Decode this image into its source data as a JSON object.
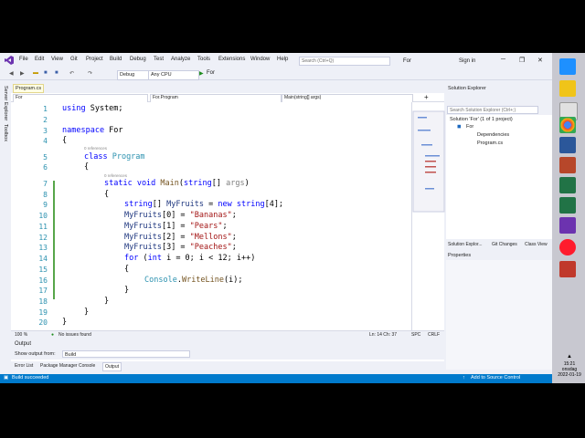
{
  "menu": [
    "File",
    "Edit",
    "View",
    "Git",
    "Project",
    "Build",
    "Debug",
    "Test",
    "Analyze",
    "Tools",
    "Extensions",
    "Window",
    "Help"
  ],
  "search_placeholder": "Search (Ctrl+Q)",
  "solution_name": "For",
  "sign_in": "Sign in",
  "toolbar": {
    "config": "Debug",
    "platform": "Any CPU",
    "run": "For"
  },
  "sidebar": [
    "Server Explorer",
    "Toolbox"
  ],
  "doc_tab": "Program.cs",
  "nav": {
    "project": "For",
    "class": "For.Program",
    "member": "Main(string[] args)"
  },
  "codelens": "0 references",
  "code_lines": [
    {
      "n": "1"
    },
    {
      "n": "2"
    },
    {
      "n": "3"
    },
    {
      "n": "4"
    },
    {
      "n": "5"
    },
    {
      "n": "6"
    },
    {
      "n": "7"
    },
    {
      "n": "8"
    },
    {
      "n": "9"
    },
    {
      "n": "10"
    },
    {
      "n": "11"
    },
    {
      "n": "12"
    },
    {
      "n": "13"
    },
    {
      "n": "14"
    },
    {
      "n": "15"
    },
    {
      "n": "16"
    },
    {
      "n": "17"
    },
    {
      "n": "18"
    },
    {
      "n": "19"
    },
    {
      "n": "20"
    }
  ],
  "code": {
    "l1_kw": "using",
    "l1_rest": " System;",
    "l3_kw": "namespace",
    "l3_rest": " For",
    "l4": "{",
    "l5_kw": "class",
    "l5_ty": " Program",
    "l6": "{",
    "l7_kw": "static void",
    "l7_mt": " Main",
    "l7_a": "(",
    "l7_kw2": "string",
    "l7_b": "[] ",
    "l7_pa": "args",
    "l7_c": ")",
    "l8": "{",
    "l9_kw": "string",
    "l9_a": "[] ",
    "l9_pa": "MyFruits",
    "l9_b": " = ",
    "l9_kw2": "new string",
    "l9_c": "[4];",
    "l10_pa": "MyFruits",
    "l10_a": "[0] = ",
    "l10_st": "\"Bananas\"",
    "l10_b": ";",
    "l11_pa": "MyFruits",
    "l11_a": "[1] = ",
    "l11_st": "\"Pears\"",
    "l11_b": ";",
    "l12_pa": "MyFruits",
    "l12_a": "[2] = ",
    "l12_st": "\"Mellons\"",
    "l12_b": ";",
    "l13_pa": "MyFruits",
    "l13_a": "[3] = ",
    "l13_st": "\"Peaches\"",
    "l13_b": ";",
    "l14_kw": "for",
    "l14_a": " (",
    "l14_kw2": "int",
    "l14_b": " i = 0; i < 12; i++)",
    "l15": "{",
    "l16_ty": "Console",
    "l16_a": ".",
    "l16_mt": "WriteLine",
    "l16_b": "(i);",
    "l17": "}",
    "l18": "}",
    "l19": "}",
    "l20": "}"
  },
  "editor_status": {
    "zoom": "100 %",
    "issues": "No issues found",
    "position": "Ln: 14   Ch: 37",
    "spc": "SPC",
    "crlf": "CRLF"
  },
  "solution_explorer": {
    "title": "Solution Explorer",
    "search": "Search Solution Explorer (Ctrl+;)",
    "solution": "Solution 'For' (1 of 1 project)",
    "project": "For",
    "dependencies": "Dependencies",
    "file": "Program.cs",
    "tabs": [
      "Solution Explor...",
      "Git Changes",
      "Class View"
    ]
  },
  "properties_title": "Properties",
  "output": {
    "title": "Output",
    "show_from_label": "Show output from:",
    "show_from_value": "Build"
  },
  "bottom_tabs": [
    "Error List",
    "Package Manager Console",
    "Output"
  ],
  "status": {
    "left": "Build succeeded",
    "right": "Add to Source Control"
  },
  "clock": {
    "time": "15:21",
    "day": "onsdag",
    "date": "2022-01-19"
  }
}
